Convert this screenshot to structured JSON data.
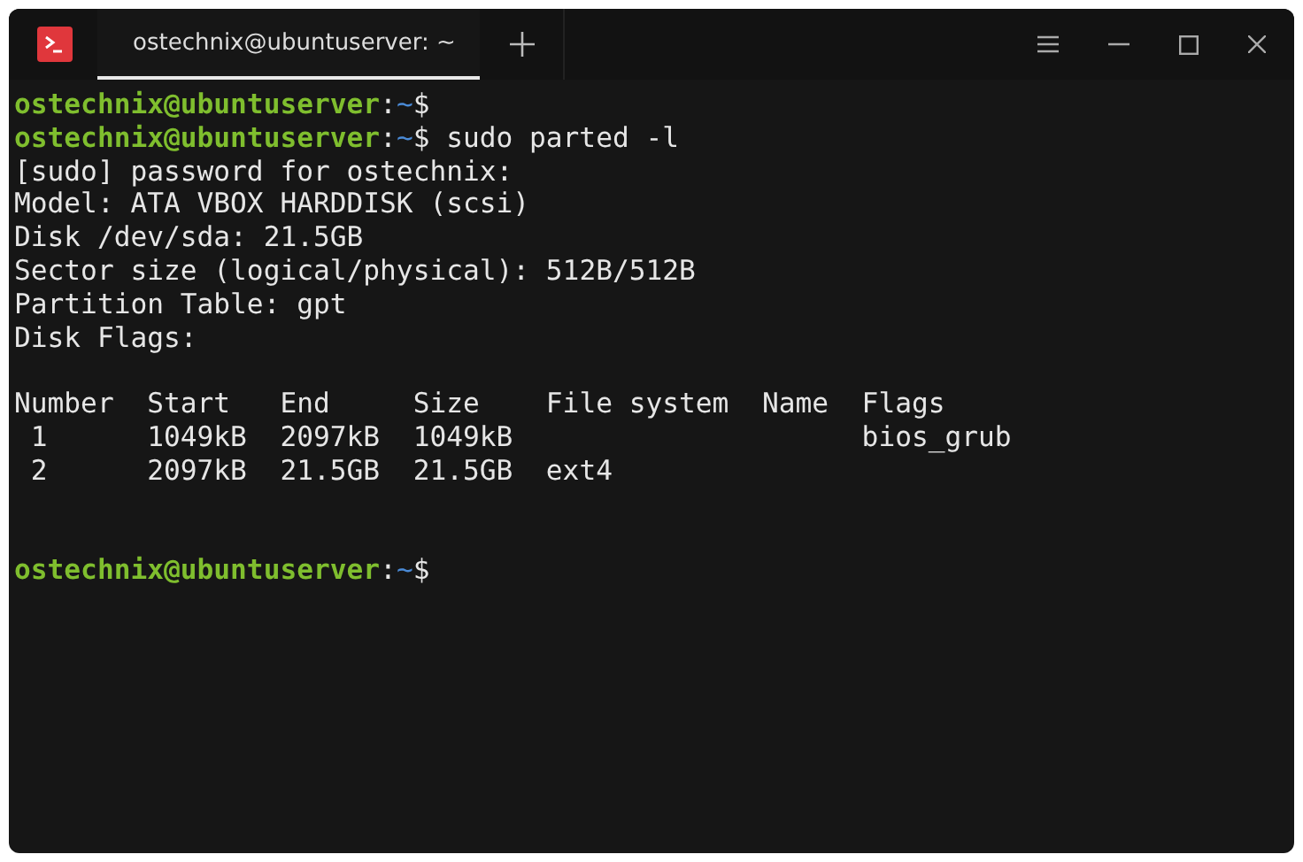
{
  "tabs": [
    {
      "title": "ostechnix@ubuntuserver: ~",
      "selected": true
    }
  ],
  "lines": [
    {
      "kind": "prompt",
      "user_host": "ostechnix@ubuntuserver",
      "separator": ":",
      "path": "~",
      "symbol": "$"
    },
    {
      "kind": "prompt",
      "user_host": "ostechnix@ubuntuserver",
      "separator": ":",
      "path": "~",
      "symbol": "$",
      "command": "sudo parted -l"
    },
    {
      "kind": "output",
      "text": "[sudo] password for ostechnix:"
    },
    {
      "kind": "output",
      "text": "Model: ATA VBOX HARDDISK (scsi)"
    },
    {
      "kind": "output",
      "text": "Disk /dev/sda: 21.5GB"
    },
    {
      "kind": "output",
      "text": "Sector size (logical/physical): 512B/512B"
    },
    {
      "kind": "output",
      "text": "Partition Table: gpt"
    },
    {
      "kind": "output",
      "text": "Disk Flags:"
    },
    {
      "kind": "blank"
    },
    {
      "kind": "output",
      "text": "Number  Start   End     Size    File system  Name  Flags"
    },
    {
      "kind": "output",
      "text": " 1      1049kB  2097kB  1049kB                     bios_grub"
    },
    {
      "kind": "output",
      "text": " 2      2097kB  21.5GB  21.5GB  ext4"
    },
    {
      "kind": "blank"
    },
    {
      "kind": "blank"
    },
    {
      "kind": "prompt",
      "user_host": "ostechnix@ubuntuserver",
      "separator": ":",
      "path": "~",
      "symbol": "$"
    }
  ]
}
